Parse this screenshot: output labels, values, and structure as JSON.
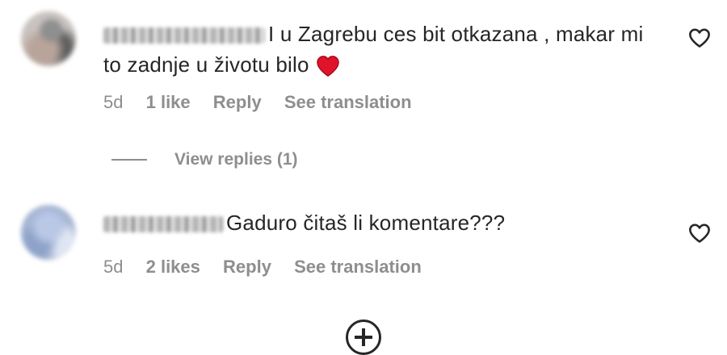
{
  "comments": [
    {
      "text_line1": "I u Zagrebu ces bit otkazana , makar mi",
      "text_line2": "to zadnje u životu bilo",
      "meta": {
        "age": "5d",
        "likes": "1 like",
        "reply": "Reply",
        "translate": "See translation"
      },
      "view_replies": "View replies (1)",
      "emoji": "heart-emoji-icon"
    },
    {
      "text_line1": "Gaduro čitaš li komentare???",
      "meta": {
        "age": "5d",
        "likes": "2 likes",
        "reply": "Reply",
        "translate": "See translation"
      }
    }
  ],
  "icons": {
    "like": "heart-outline-icon",
    "load_more": "plus-circle-icon"
  },
  "colors": {
    "text": "#262626",
    "secondary": "#8e8e8e",
    "heart_emoji": "#e0132b"
  }
}
